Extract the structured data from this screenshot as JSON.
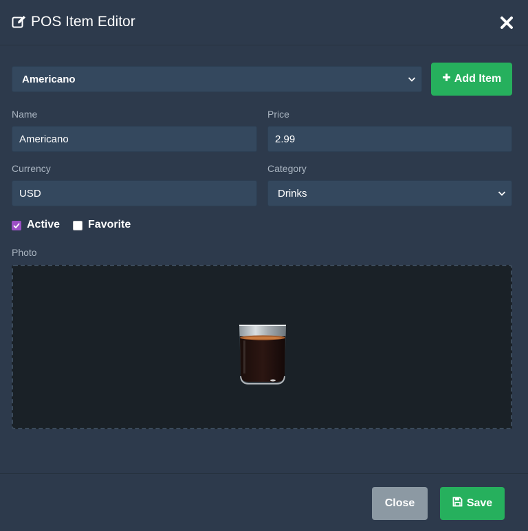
{
  "modal": {
    "title": "POS Item Editor",
    "title_icon": "edit-icon",
    "close_icon": "close-icon"
  },
  "item_select": {
    "value": "Americano",
    "icon": "chevron-down-icon"
  },
  "add_item": {
    "label": "Add Item",
    "icon": "plus-icon"
  },
  "fields": {
    "name": {
      "label": "Name",
      "value": "Americano"
    },
    "price": {
      "label": "Price",
      "value": "2.99"
    },
    "currency": {
      "label": "Currency",
      "value": "USD"
    },
    "category": {
      "label": "Category",
      "value": "Drinks"
    }
  },
  "checkboxes": {
    "active": {
      "label": "Active",
      "checked": true
    },
    "favorite": {
      "label": "Favorite",
      "checked": false
    }
  },
  "photo": {
    "label": "Photo",
    "image": "coffee-glass"
  },
  "footer": {
    "close_label": "Close",
    "save_label": "Save",
    "save_icon": "save-icon"
  },
  "colors": {
    "background": "#2d3a4c",
    "input_bg": "#34485e",
    "accent_green": "#26b05d",
    "checkbox_purple": "#9b4fc4",
    "close_button": "#8c99a3",
    "photo_bg": "#1a2127"
  }
}
